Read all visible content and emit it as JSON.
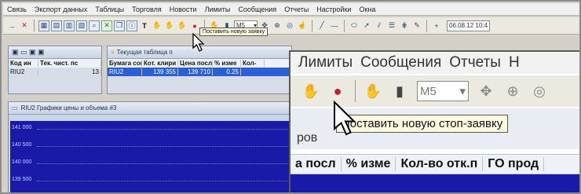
{
  "menu": [
    "Связь",
    "Экспорт данных",
    "Таблицы",
    "Торговля",
    "Новости",
    "Лимиты",
    "Сообщения",
    "Отчеты",
    "Настройки",
    "Окна"
  ],
  "toolbar": {
    "timeframe": "M5",
    "datetime": "06.08.12 10:4"
  },
  "tooltip_small": "Поставить новую заявку",
  "portfolio_panel": {
    "headers": [
      "Код ин",
      "Тек. чист. пс"
    ],
    "row": [
      "RIU2",
      "13"
    ]
  },
  "quotes_panel": {
    "title": "Текущая таблица п",
    "headers": [
      "Бумага сок",
      "Кот. клири",
      "Цена посл",
      "% изме",
      "Кол-"
    ],
    "row": [
      "RIU2",
      "139 355",
      "139 710",
      "0.25",
      ""
    ]
  },
  "chart": {
    "title": "RIU2 Графики цены и объема #3",
    "y_labels": [
      "141 000",
      "140 500",
      "140 000",
      "139 500"
    ]
  },
  "zoom": {
    "menu": [
      "Лимиты",
      "Сообщения",
      "Отчеты",
      "Н"
    ],
    "timeframe": "M5",
    "tooltip": "Поставить новую стоп-заявку",
    "partial_text": "ров",
    "headers": [
      "а посл",
      "% изме",
      "Кол-во отк.п",
      "ГО прод"
    ]
  },
  "colors": {
    "chart_bg": "#1a1aa8",
    "selected_row": "#2a5fd6",
    "tooltip_bg": "#fffbe0"
  }
}
